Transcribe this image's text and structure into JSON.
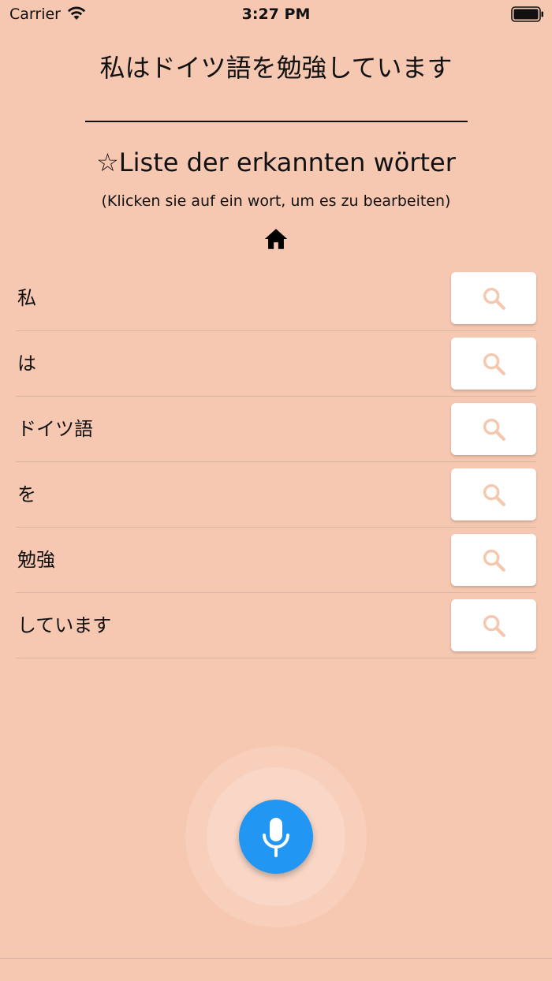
{
  "colors": {
    "background": "#f6c8b1",
    "accent_blue": "#2196f3",
    "search_icon": "#f4c7ae",
    "card": "#ffffff",
    "glow": "#f9d6c5"
  },
  "status_bar": {
    "carrier": "Carrier",
    "time": "3:27 PM"
  },
  "header": {
    "sentence": "私はドイツ語を勉強しています",
    "list_title": "☆Liste der erkannten wörter",
    "list_subtitle": "(Klicken sie auf ein wort, um es zu bearbeiten)",
    "home_icon": "home-icon"
  },
  "words": [
    {
      "text": "私"
    },
    {
      "text": "は"
    },
    {
      "text": "ドイツ語"
    },
    {
      "text": "を"
    },
    {
      "text": "勉強"
    },
    {
      "text": "しています"
    }
  ],
  "icons": {
    "search": "search-icon",
    "mic": "microphone-icon",
    "wifi": "wifi-icon",
    "battery": "battery-icon"
  }
}
